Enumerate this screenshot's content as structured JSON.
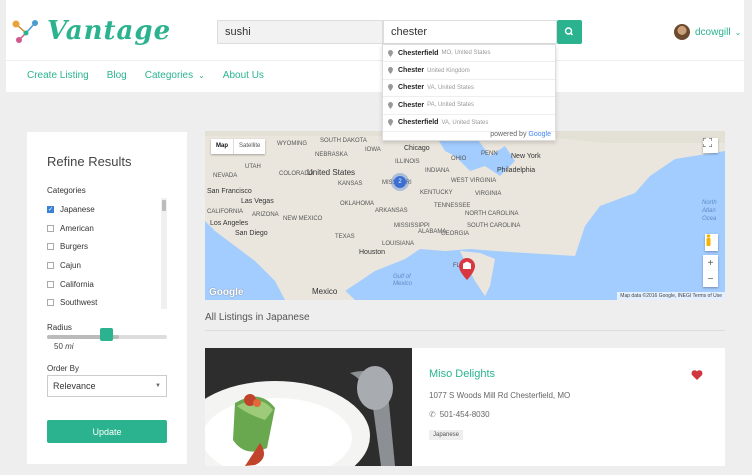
{
  "brand": {
    "name": "Vantage",
    "color": "#2bb38f"
  },
  "search": {
    "keyword_value": "sushi",
    "location_value": "chester",
    "button_icon": "search-icon"
  },
  "user": {
    "name": "dcowgill",
    "avatar_icon": "avatar"
  },
  "nav": {
    "items": [
      {
        "label": "Create Listing"
      },
      {
        "label": "Blog"
      },
      {
        "label": "Categories",
        "has_dropdown": true
      },
      {
        "label": "About Us"
      }
    ]
  },
  "autocomplete": {
    "suggestions": [
      {
        "main": "Chesterfield",
        "secondary": "MO, United States"
      },
      {
        "main": "Chester",
        "secondary": "United Kingdom"
      },
      {
        "main": "Chester",
        "secondary": "VA, United States"
      },
      {
        "main": "Chester",
        "secondary": "PA, United States"
      },
      {
        "main": "Chesterfield",
        "secondary": "VA, United States"
      }
    ],
    "powered_by": "powered by",
    "google": "Google"
  },
  "sidebar": {
    "title": "Refine Results",
    "categories_label": "Categories",
    "categories": [
      {
        "label": "Japanese",
        "checked": true
      },
      {
        "label": "American",
        "checked": false
      },
      {
        "label": "Burgers",
        "checked": false
      },
      {
        "label": "Cajun",
        "checked": false
      },
      {
        "label": "California",
        "checked": false
      },
      {
        "label": "Southwest",
        "checked": false
      }
    ],
    "radius_label": "Radius",
    "radius_value": "50",
    "radius_unit": "mi",
    "radius_fraction": 0.6,
    "order_label": "Order By",
    "order_value": "Relevance",
    "update_label": "Update"
  },
  "map": {
    "type_map": "Map",
    "type_satellite": "Satellite",
    "cluster_count": "2",
    "google_label": "Google",
    "attribution": "Map data ©2016 Google, INEGI   Terms of Use",
    "labels": {
      "wyoming": "WYOMING",
      "south_dakota": "SOUTH DAKOTA",
      "nebraska": "NEBRASKA",
      "iowa": "IOWA",
      "illinois": "ILLINOIS",
      "indiana": "INDIANA",
      "ohio": "OHIO",
      "penn": "PENN",
      "new_york": "NEW YORK",
      "chicago": "Chicago",
      "new_york_city": "New York",
      "philadelphia": "Philadelphia",
      "nevada": "NEVADA",
      "utah": "UTAH",
      "colorado": "COLORADO",
      "united_states": "United States",
      "kansas": "KANSAS",
      "missouri": "MISSOURI",
      "kentucky": "KENTUCKY",
      "west_virginia": "WEST VIRGINIA",
      "virginia": "VIRGINIA",
      "sf": "San Francisco",
      "las_vegas": "Las Vegas",
      "california": "CALIFORNIA",
      "los_angeles": "Los Angeles",
      "san_diego": "San Diego",
      "arizona": "ARIZONA",
      "new_mexico": "NEW MEXICO",
      "oklahoma": "OKLAHOMA",
      "arkansas": "ARKANSAS",
      "tennessee": "TENNESSEE",
      "north_carolina": "NORTH CAROLINA",
      "south_carolina": "SOUTH CAROLINA",
      "mississippi": "MISSISSIPPI",
      "alabama": "ALABAMA",
      "georgia": "GEORGIA",
      "texas": "TEXAS",
      "louisiana": "LOUISIANA",
      "florida": "FLO",
      "houston": "Houston",
      "gulf": "Gulf of Mexico",
      "mexico": "Mexico",
      "north_atlantic": "North Atlan Ocea"
    }
  },
  "listings": {
    "title": "All Listings in Japanese",
    "items": [
      {
        "name": "Miso Delights",
        "address": "1077 S Woods Mill Rd Chesterfield, MO",
        "phone": "501-454-8030",
        "tag": "Japanese",
        "favorite": true,
        "favorite_color": "#d0363e"
      }
    ]
  }
}
